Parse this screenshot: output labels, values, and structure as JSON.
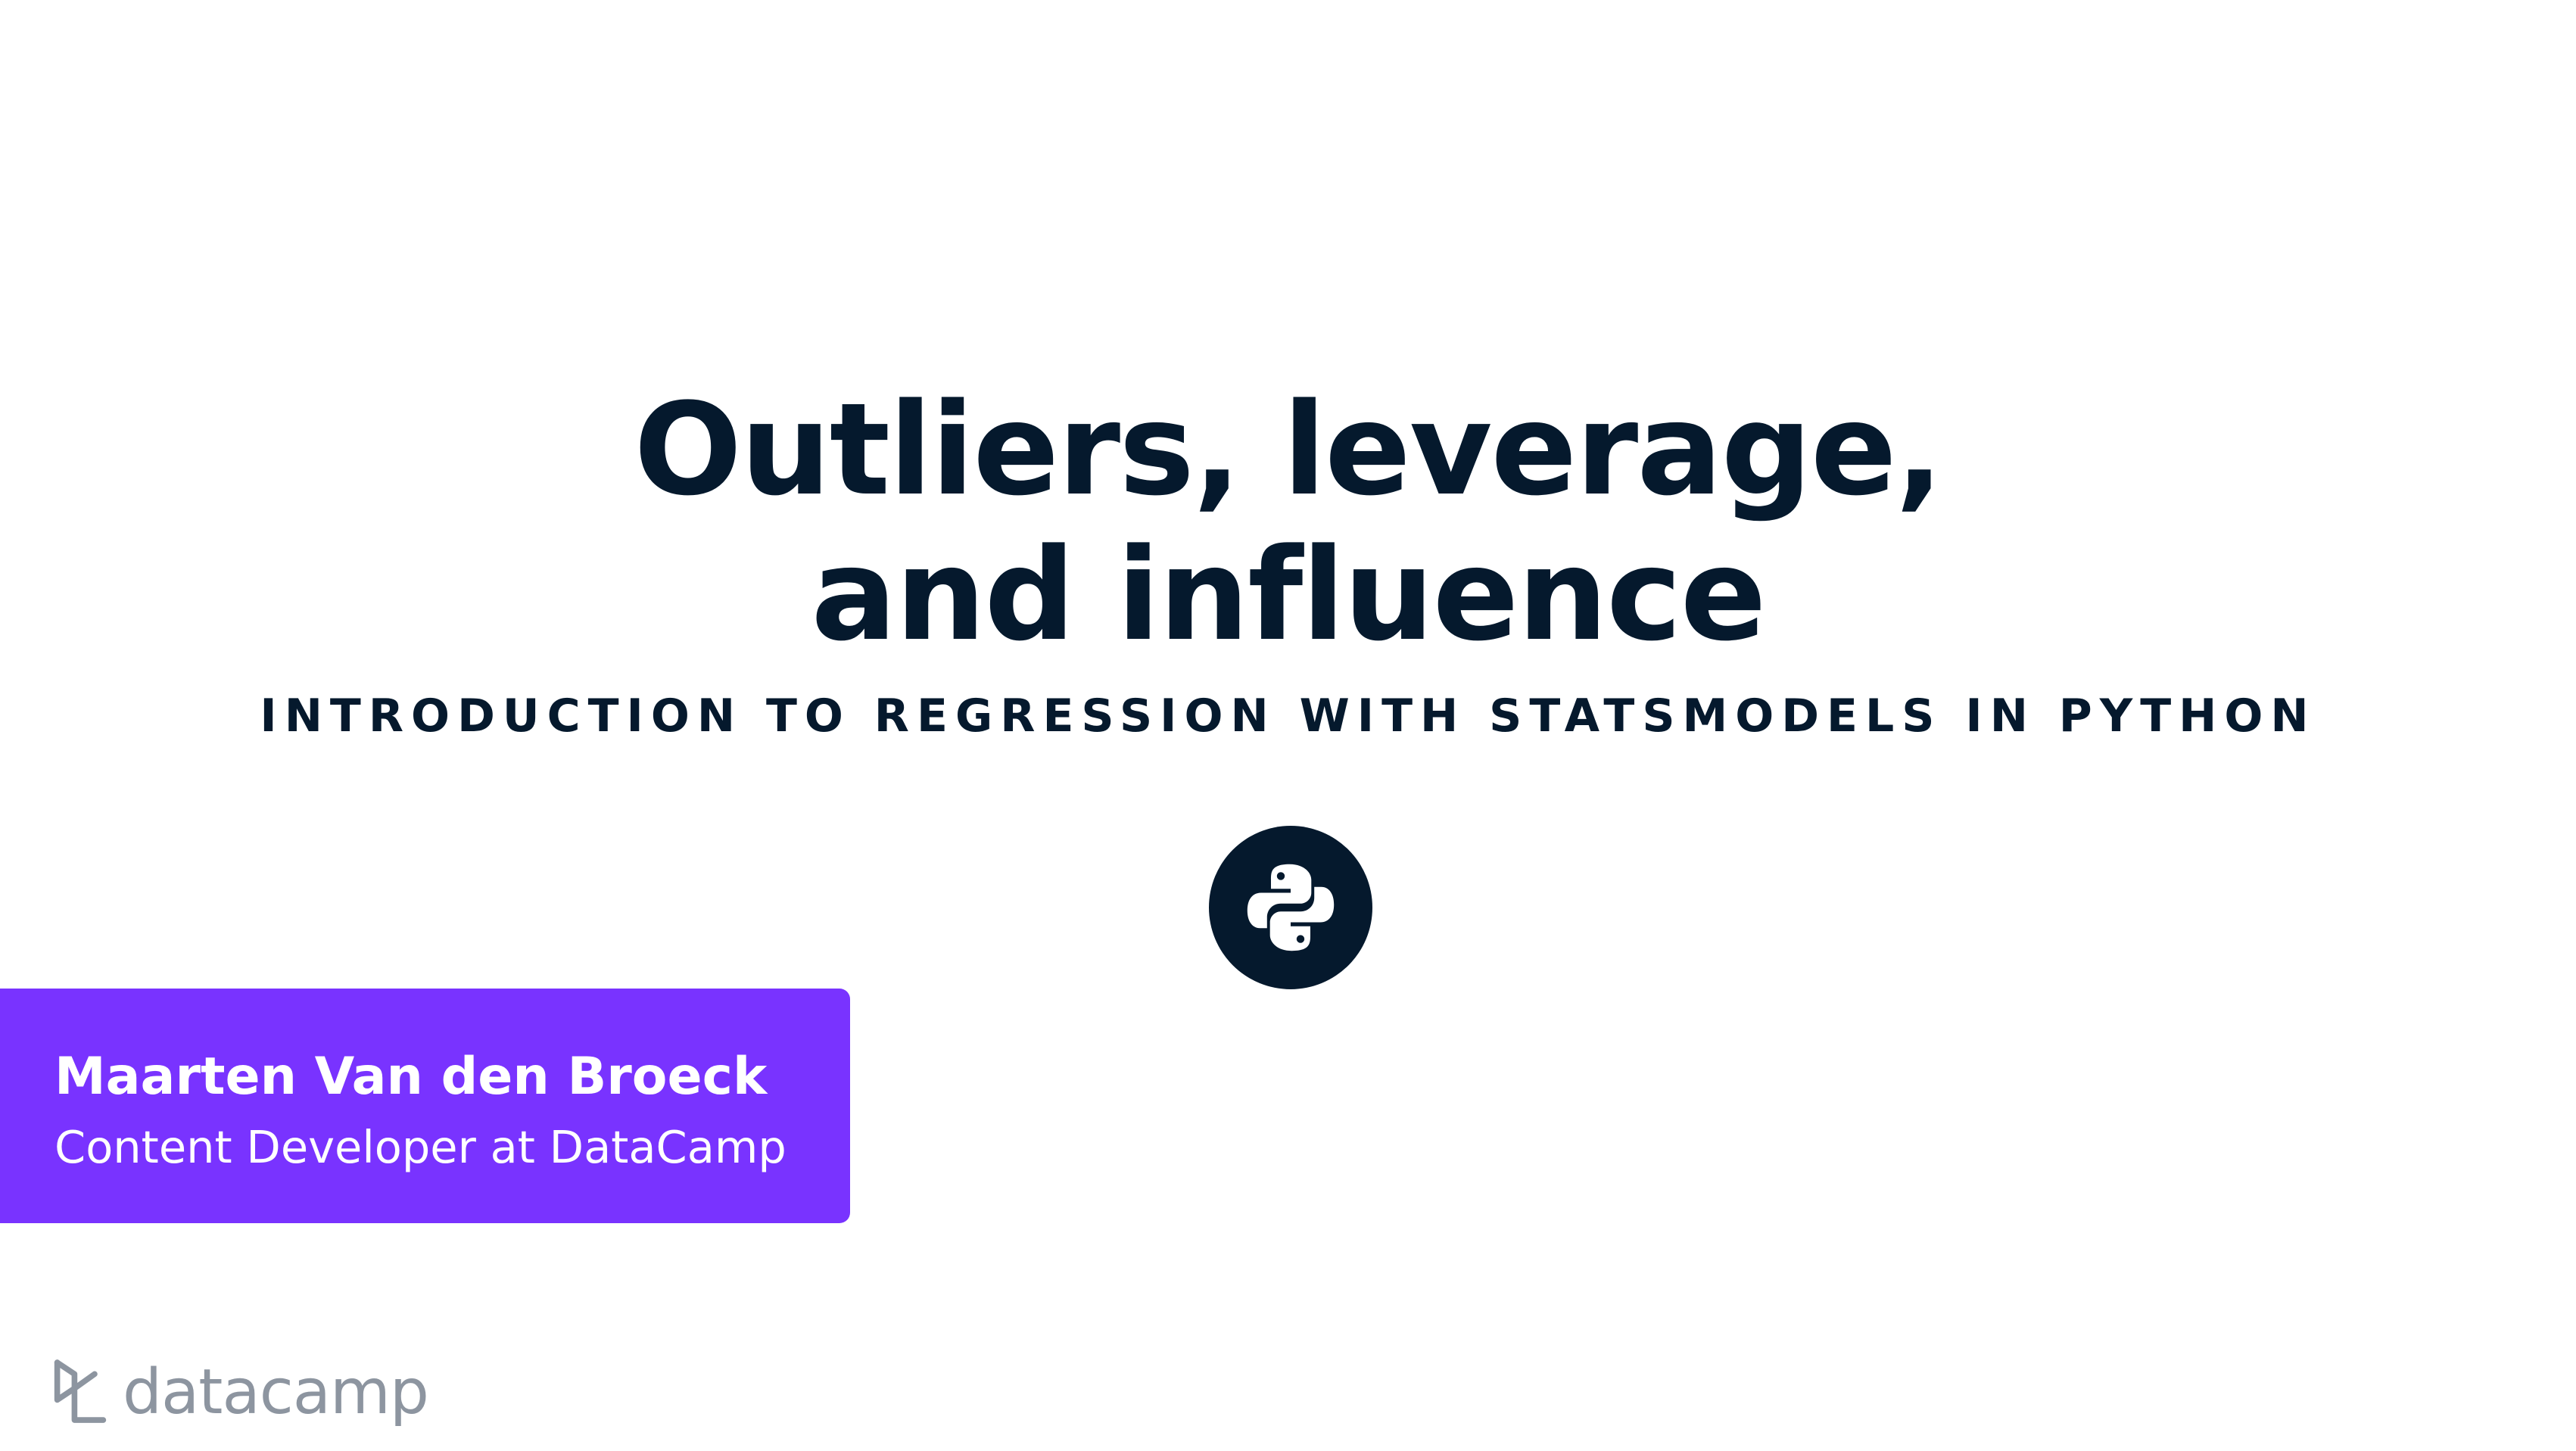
{
  "slide": {
    "title_line1": "Outliers, leverage,",
    "title_line2": "and influence",
    "course": "INTRODUCTION TO REGRESSION WITH STATSMODELS IN PYTHON",
    "icon": "python-logo-icon"
  },
  "author": {
    "name": "Maarten Van den Broeck",
    "role": "Content Developer at DataCamp"
  },
  "brand": {
    "logo_text": "datacamp",
    "logo_icon": "datacamp-logo-icon"
  },
  "colors": {
    "title": "#05192d",
    "author_box": "#7933ff",
    "logo": "#8d95a0"
  }
}
